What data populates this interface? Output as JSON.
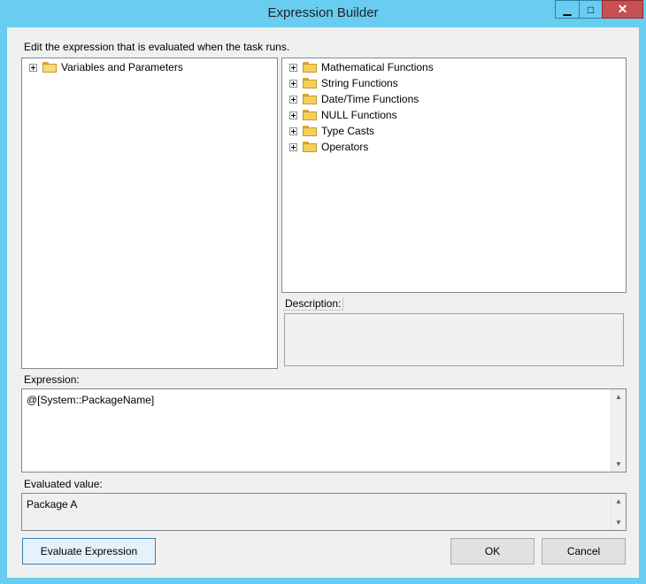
{
  "window": {
    "title": "Expression Builder",
    "min_glyph": "▁",
    "max_glyph": "□",
    "close_glyph": "✕"
  },
  "instruction": "Edit the expression that is evaluated when the task runs.",
  "left_tree": {
    "items": [
      {
        "label": "Variables and Parameters",
        "icon": "folder-open-icon"
      }
    ]
  },
  "right_tree": {
    "items": [
      {
        "label": "Mathematical Functions",
        "icon": "folder-icon"
      },
      {
        "label": "String Functions",
        "icon": "folder-icon"
      },
      {
        "label": "Date/Time Functions",
        "icon": "folder-icon"
      },
      {
        "label": "NULL Functions",
        "icon": "folder-icon"
      },
      {
        "label": "Type Casts",
        "icon": "folder-icon"
      },
      {
        "label": "Operators",
        "icon": "folder-icon"
      }
    ]
  },
  "description": {
    "label": "Description:",
    "text": ""
  },
  "expression": {
    "label": "Expression:",
    "value": "@[System::PackageName]"
  },
  "evaluated": {
    "label": "Evaluated value:",
    "value": "Package A"
  },
  "buttons": {
    "evaluate": "Evaluate Expression",
    "ok": "OK",
    "cancel": "Cancel"
  },
  "glyphs": {
    "up": "▲",
    "down": "▼"
  }
}
